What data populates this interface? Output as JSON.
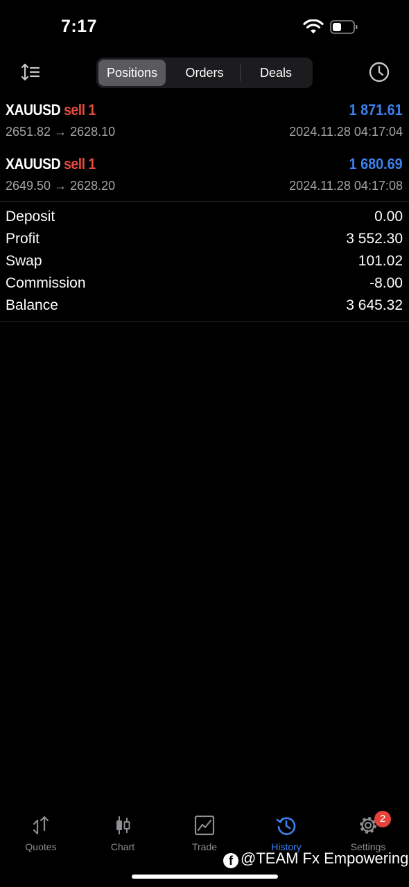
{
  "status_bar": {
    "time": "7:17"
  },
  "segments": [
    {
      "label": "Positions",
      "active": true
    },
    {
      "label": "Orders",
      "active": false
    },
    {
      "label": "Deals",
      "active": false
    }
  ],
  "positions": [
    {
      "symbol": "XAUUSD",
      "side": "sell 1",
      "profit": "1 871.61",
      "open_close": "2651.82 → 2628.10",
      "time": "2024.11.28 04:17:04"
    },
    {
      "symbol": "XAUUSD",
      "side": "sell 1",
      "profit": "1 680.69",
      "open_close": "2649.50 → 2628.20",
      "time": "2024.11.28 04:17:08"
    }
  ],
  "summary": [
    {
      "label": "Deposit",
      "value": "0.00"
    },
    {
      "label": "Profit",
      "value": "3 552.30"
    },
    {
      "label": "Swap",
      "value": "101.02"
    },
    {
      "label": "Commission",
      "value": "-8.00"
    },
    {
      "label": "Balance",
      "value": "3 645.32"
    }
  ],
  "tabs": [
    {
      "label": "Quotes",
      "icon": "quotes-icon"
    },
    {
      "label": "Chart",
      "icon": "candles-icon"
    },
    {
      "label": "Trade",
      "icon": "trade-chart-icon"
    },
    {
      "label": "History",
      "icon": "history-icon",
      "active": true
    },
    {
      "label": "Settings",
      "icon": "gear-icon",
      "badge": "2"
    }
  ],
  "watermark": {
    "text": "@TEAM Fx Empowering"
  },
  "colors": {
    "accent": "#3b82f0",
    "sell": "#e84a40",
    "badge": "#e8433a"
  }
}
